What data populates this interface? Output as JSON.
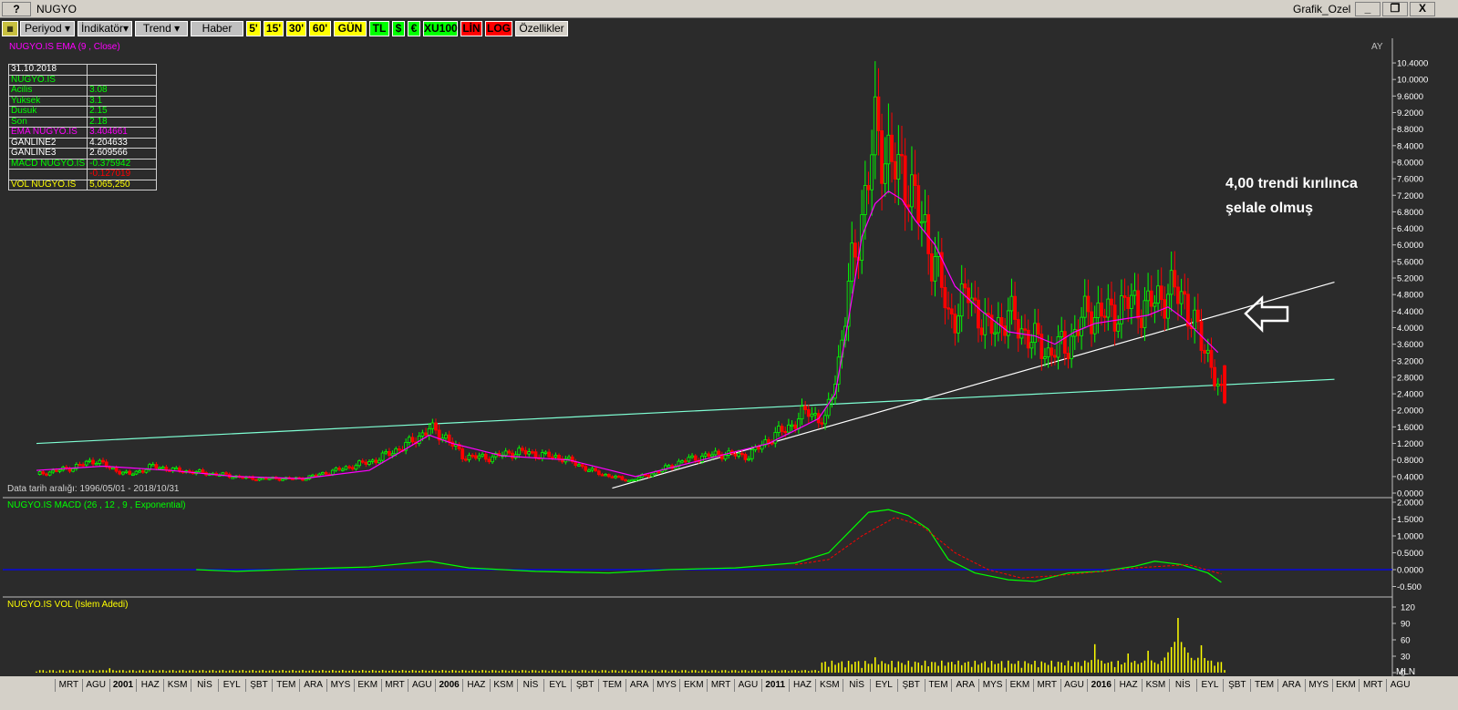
{
  "window": {
    "help_label": "?",
    "title": "NUGYO",
    "right_title": "Grafik_Ozel",
    "min": "_",
    "restore": "❐",
    "close": "X"
  },
  "toolbar": {
    "periyod": "Periyod",
    "indikator": "İndikatör",
    "trend": "Trend",
    "haber": "Haber",
    "p5": "5'",
    "p15": "15'",
    "p30": "30'",
    "p60": "60'",
    "gun": "GÜN",
    "tl": "TL",
    "usd": "$",
    "eur": "€",
    "xu100": "XU100",
    "lin": "LİN",
    "log": "LOG",
    "ozellikler": "Özellikler"
  },
  "main": {
    "title": "NUGYO.IS EMA (9 , Close)",
    "period": "AY",
    "date_range": "Data tarih aralığı: 1996/05/01 - 2018/10/31"
  },
  "info_table": [
    {
      "label": "31.10.2018",
      "value": "",
      "color": "#ffffff"
    },
    {
      "label": "NUGYO.IS",
      "value": "",
      "color": "#00ff00"
    },
    {
      "label": " Acilis",
      "value": "3.08",
      "color": "#00ff00"
    },
    {
      "label": " Yuksek",
      "value": "3.1",
      "color": "#00ff00"
    },
    {
      "label": " Dusuk",
      "value": "2.15",
      "color": "#00ff00"
    },
    {
      "label": " Son",
      "value": "2.18",
      "color": "#00ff00"
    },
    {
      "label": "EMA NUGYO.IS",
      "value": "3.404661",
      "color": "#ff00ff"
    },
    {
      "label": "GANLINE2",
      "value": "4.204633",
      "color": "#ffffff"
    },
    {
      "label": "GANLINE3",
      "value": "2.609566",
      "color": "#ffffff"
    },
    {
      "label": "MACD NUGYO.IS",
      "value": "-0.375942",
      "color": "#00ff00"
    },
    {
      "label": "",
      "value": "-0.127019",
      "color": "#ff0000"
    },
    {
      "label": "VOL NUGYO.IS",
      "value": "5,065,250",
      "color": "#ffff00"
    }
  ],
  "annotation": {
    "line1": "4,00 trendi kırılınca",
    "line2": "şelale olmuş"
  },
  "panels": {
    "macd_title": "NUGYO.IS MACD (26 , 12 , 9 , Exponential)",
    "vol_title": "NUGYO.IS VOL (Islem Adedi)",
    "vol_unit": "MLN"
  },
  "axes": {
    "price_ticks": [
      "10.4000",
      "10.0000",
      "9.6000",
      "9.2000",
      "8.8000",
      "8.4000",
      "8.0000",
      "7.6000",
      "7.2000",
      "6.8000",
      "6.4000",
      "6.0000",
      "5.6000",
      "5.2000",
      "4.8000",
      "4.4000",
      "4.0000",
      "3.6000",
      "3.2000",
      "2.8000",
      "2.4000",
      "2.0000",
      "1.6000",
      "1.2000",
      "0.8000",
      "0.4000",
      "0.0000"
    ],
    "macd_ticks": [
      "2.0000",
      "1.5000",
      "1.0000",
      "0.5000",
      "0.0000",
      "-0.500"
    ],
    "vol_ticks": [
      "120",
      "90",
      "60",
      "30",
      "0"
    ],
    "x_labels": [
      "MRT",
      "AGU",
      "2001",
      "HAZ",
      "KSM",
      "NİS",
      "EYL",
      "ŞBT",
      "TEM",
      "ARA",
      "MYS",
      "EKM",
      "MRT",
      "AGU",
      "2006",
      "HAZ",
      "KSM",
      "NİS",
      "EYL",
      "ŞBT",
      "TEM",
      "ARA",
      "MYS",
      "EKM",
      "MRT",
      "AGU",
      "2011",
      "HAZ",
      "KSM",
      "NİS",
      "EYL",
      "ŞBT",
      "TEM",
      "ARA",
      "MYS",
      "EKM",
      "MRT",
      "AGU",
      "2016",
      "HAZ",
      "KSM",
      "NİS",
      "EYL",
      "ŞBT",
      "TEM",
      "ARA",
      "MYS",
      "EKM",
      "MRT",
      "AGU"
    ]
  },
  "colors": {
    "up": "#00ff00",
    "down": "#ff0000",
    "ema": "#ff00ff",
    "macd": "#00ff00",
    "signal": "#ff0000",
    "trend1": "#ffffff",
    "trend2": "#7fffd4",
    "zero": "#0000ff",
    "volume": "#ffff00"
  },
  "chart_data": [
    {
      "type": "candlestick",
      "title": "NUGYO.IS EMA (9 , Close)",
      "period": "AY",
      "ylim": [
        0,
        10.4
      ],
      "summary": {
        "date": "31.10.2018",
        "open": 3.08,
        "high": 3.1,
        "low": 2.15,
        "close": 2.18,
        "ema9": 3.404661,
        "ganline2": 4.204633,
        "ganline3": 2.609566
      },
      "price_path": [
        [
          0,
          0.45
        ],
        [
          10,
          0.6
        ],
        [
          18,
          0.8
        ],
        [
          22,
          0.6
        ],
        [
          28,
          0.45
        ],
        [
          35,
          0.65
        ],
        [
          42,
          0.55
        ],
        [
          55,
          0.45
        ],
        [
          65,
          0.35
        ],
        [
          80,
          0.35
        ],
        [
          90,
          0.55
        ],
        [
          102,
          0.8
        ],
        [
          112,
          1.2
        ],
        [
          118,
          1.55
        ],
        [
          123,
          1.35
        ],
        [
          128,
          0.9
        ],
        [
          135,
          0.85
        ],
        [
          145,
          1.0
        ],
        [
          158,
          0.85
        ],
        [
          168,
          0.5
        ],
        [
          178,
          0.3
        ],
        [
          186,
          0.5
        ],
        [
          195,
          0.8
        ],
        [
          205,
          0.95
        ],
        [
          214,
          0.9
        ],
        [
          220,
          1.3
        ],
        [
          226,
          1.6
        ],
        [
          232,
          2.0
        ],
        [
          237,
          1.7
        ],
        [
          241,
          3.2
        ],
        [
          245,
          5.4
        ],
        [
          249,
          7.2
        ],
        [
          252,
          8.6
        ],
        [
          255,
          8.4
        ],
        [
          259,
          7.6
        ],
        [
          262,
          7.7
        ],
        [
          266,
          6.4
        ],
        [
          270,
          5.7
        ],
        [
          274,
          4.2
        ],
        [
          280,
          4.8
        ],
        [
          286,
          3.9
        ],
        [
          292,
          4.3
        ],
        [
          298,
          3.8
        ],
        [
          304,
          3.4
        ],
        [
          310,
          3.6
        ],
        [
          316,
          4.4
        ],
        [
          322,
          4.3
        ],
        [
          328,
          4.6
        ],
        [
          334,
          4.5
        ],
        [
          340,
          4.9
        ],
        [
          345,
          4.7
        ],
        [
          350,
          3.6
        ],
        [
          353,
          3.2
        ],
        [
          355,
          2.5
        ],
        [
          357,
          2.18
        ]
      ],
      "ema_path": [
        [
          0,
          0.55
        ],
        [
          20,
          0.65
        ],
        [
          40,
          0.55
        ],
        [
          60,
          0.4
        ],
        [
          80,
          0.35
        ],
        [
          100,
          0.55
        ],
        [
          118,
          1.4
        ],
        [
          125,
          1.2
        ],
        [
          140,
          0.9
        ],
        [
          160,
          0.8
        ],
        [
          180,
          0.4
        ],
        [
          200,
          0.8
        ],
        [
          220,
          1.2
        ],
        [
          235,
          1.8
        ],
        [
          240,
          2.4
        ],
        [
          244,
          4.2
        ],
        [
          248,
          6.2
        ],
        [
          252,
          7.0
        ],
        [
          256,
          7.3
        ],
        [
          260,
          7.1
        ],
        [
          264,
          6.6
        ],
        [
          270,
          6.0
        ],
        [
          276,
          5.0
        ],
        [
          284,
          4.4
        ],
        [
          292,
          3.9
        ],
        [
          300,
          3.8
        ],
        [
          306,
          3.6
        ],
        [
          312,
          3.9
        ],
        [
          318,
          4.1
        ],
        [
          326,
          4.2
        ],
        [
          334,
          4.3
        ],
        [
          340,
          4.5
        ],
        [
          345,
          4.2
        ],
        [
          350,
          3.8
        ],
        [
          355,
          3.4
        ]
      ],
      "trendlines": [
        {
          "name": "GANLINE2",
          "from": [
            173,
            0.12
          ],
          "to": [
            390,
            5.1
          ]
        },
        {
          "name": "GANLINE3",
          "from": [
            0,
            1.2
          ],
          "to": [
            390,
            2.75
          ]
        }
      ],
      "annotation": "4,00 trendi kırılınca şelale olmuş"
    },
    {
      "type": "line",
      "title": "NUGYO.IS MACD (26 , 12 , 9 , Exponential)",
      "ylim": [
        -0.5,
        2.0
      ],
      "series": [
        {
          "name": "MACD",
          "values": [
            [
              48,
              0.0
            ],
            [
              60,
              -0.05
            ],
            [
              80,
              0.02
            ],
            [
              100,
              0.08
            ],
            [
              118,
              0.25
            ],
            [
              130,
              0.05
            ],
            [
              150,
              -0.05
            ],
            [
              172,
              -0.1
            ],
            [
              190,
              0.0
            ],
            [
              210,
              0.05
            ],
            [
              228,
              0.2
            ],
            [
              238,
              0.5
            ],
            [
              244,
              1.1
            ],
            [
              250,
              1.7
            ],
            [
              256,
              1.78
            ],
            [
              262,
              1.6
            ],
            [
              268,
              1.2
            ],
            [
              274,
              0.3
            ],
            [
              282,
              -0.1
            ],
            [
              292,
              -0.3
            ],
            [
              300,
              -0.35
            ],
            [
              310,
              -0.1
            ],
            [
              320,
              -0.05
            ],
            [
              330,
              0.1
            ],
            [
              336,
              0.25
            ],
            [
              344,
              0.15
            ],
            [
              352,
              -0.1
            ],
            [
              356,
              -0.376
            ]
          ]
        },
        {
          "name": "Signal",
          "values": [
            [
              228,
              0.15
            ],
            [
              238,
              0.3
            ],
            [
              248,
              1.0
            ],
            [
              258,
              1.55
            ],
            [
              266,
              1.3
            ],
            [
              276,
              0.5
            ],
            [
              286,
              0.0
            ],
            [
              296,
              -0.25
            ],
            [
              310,
              -0.15
            ],
            [
              330,
              0.05
            ],
            [
              346,
              0.15
            ],
            [
              356,
              -0.127
            ]
          ]
        }
      ]
    },
    {
      "type": "bar",
      "title": "NUGYO.IS VOL (Islem Adedi)",
      "unit": "MLN",
      "ylim": [
        0,
        120
      ],
      "peaks": [
        [
          22,
          8
        ],
        [
          240,
          12
        ],
        [
          246,
          20
        ],
        [
          252,
          28
        ],
        [
          262,
          18
        ],
        [
          276,
          15
        ],
        [
          292,
          22
        ],
        [
          300,
          15
        ],
        [
          318,
          52
        ],
        [
          328,
          35
        ],
        [
          334,
          40
        ],
        [
          343,
          100
        ],
        [
          350,
          50
        ],
        [
          356,
          5.07
        ]
      ]
    }
  ]
}
